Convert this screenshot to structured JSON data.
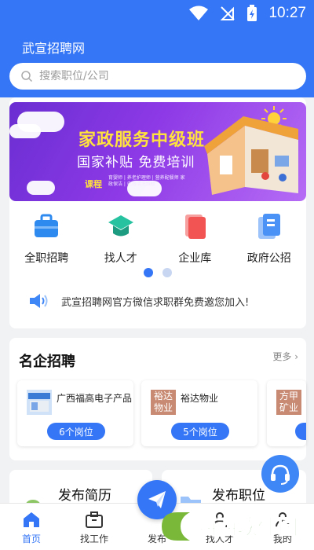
{
  "status_bar": {
    "time": "10:27"
  },
  "app": {
    "title": "武宣招聘网"
  },
  "search": {
    "placeholder": "搜索职位/公司"
  },
  "banner": {
    "title": "家政服务中级班",
    "subtitle": "国家补贴  免费培训",
    "course_label": "课程",
    "course_detail": "育婴师 | 养老护理师 | 营养配餐师 家政保洁 | 电器清洗维修"
  },
  "quick_menu": [
    {
      "label": "全职招聘",
      "icon": "briefcase-icon",
      "color": "#2f8af0"
    },
    {
      "label": "找人才",
      "icon": "graduation-cap-icon",
      "color": "#27c2a0"
    },
    {
      "label": "企业库",
      "icon": "document-icon",
      "color": "#f25454"
    },
    {
      "label": "政府公招",
      "icon": "document-blue-icon",
      "color": "#4a92f5"
    }
  ],
  "notice": {
    "text": "武宣招聘网官方微信求职群免费邀您加入!",
    "icon": "speaker-icon"
  },
  "featured": {
    "title": "名企招聘",
    "more": "更多",
    "companies": [
      {
        "name": "广西福高电子产品",
        "jobs": "6个岗位",
        "logo": "company-photo-logo"
      },
      {
        "name": "裕达物业",
        "jobs": "5个岗位",
        "logo_text": [
          "裕达",
          "物业"
        ]
      },
      {
        "name": "",
        "jobs": "",
        "logo_text": [
          "方甲",
          "矿业"
        ]
      }
    ]
  },
  "actions": {
    "resume": "发布简历",
    "job": "发布职位"
  },
  "tabs": [
    {
      "label": "首页",
      "icon": "home-icon",
      "active": true
    },
    {
      "label": "找工作",
      "icon": "briefcase-outline-icon",
      "active": false
    },
    {
      "label": "发布",
      "icon": "paper-plane-icon",
      "active": false
    },
    {
      "label": "找人才",
      "icon": "person-icon",
      "active": false
    },
    {
      "label": "我的",
      "icon": "user-icon",
      "active": false
    }
  ],
  "watermark": {
    "brand": "西西软件园"
  },
  "colors": {
    "primary": "#3476f6",
    "banner_yellow": "#ffe23d",
    "background": "#f1f2f4"
  }
}
